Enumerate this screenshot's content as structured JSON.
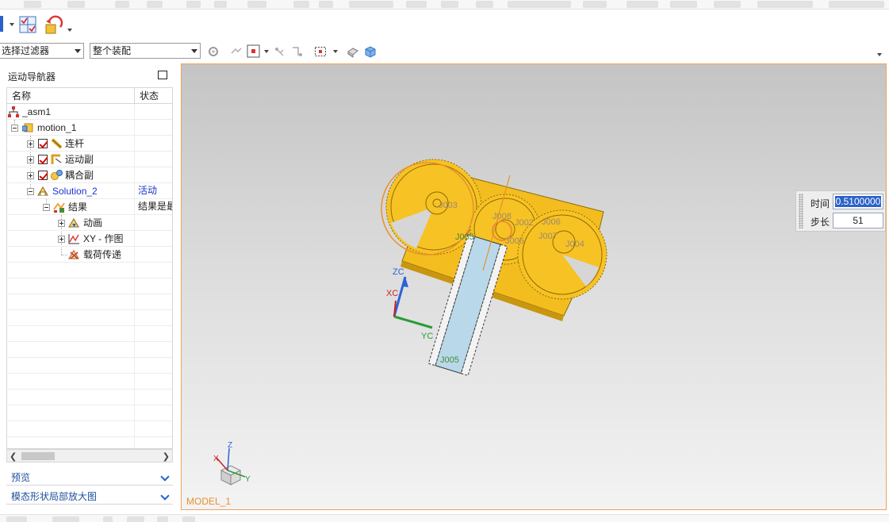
{
  "toolbar": {
    "filter_combo": "选择过滤器",
    "scope_combo": "整个装配"
  },
  "navigator": {
    "title": "运动导航器",
    "columns": {
      "name": "名称",
      "status": "状态"
    },
    "rows": [
      {
        "label": "_asm1",
        "status": ""
      },
      {
        "label": "motion_1",
        "status": ""
      },
      {
        "label": "连杆",
        "status": ""
      },
      {
        "label": "运动副",
        "status": ""
      },
      {
        "label": "耦合副",
        "status": ""
      },
      {
        "label": "Solution_2",
        "status": "活动"
      },
      {
        "label": "结果",
        "status": "结果是最"
      },
      {
        "label": "动画",
        "status": ""
      },
      {
        "label": "XY - 作图",
        "status": ""
      },
      {
        "label": "载荷传递",
        "status": ""
      }
    ]
  },
  "panels": {
    "preview": "预览",
    "magnifier": "模态形状局部放大图"
  },
  "viewport": {
    "model_name": "MODEL_1",
    "axes": {
      "zc": "ZC",
      "xc": "XC",
      "yc": "YC"
    },
    "triad": {
      "z": "Z",
      "x": "X",
      "y": "Y"
    },
    "part_labels": [
      "J003",
      "J008",
      "J002",
      "J006",
      "J007",
      "J005",
      "J004",
      "J005",
      "J005"
    ]
  },
  "animation": {
    "time_label": "时间",
    "time_value": "0.5100000",
    "step_label": "步长",
    "step_value": "51"
  },
  "colors": {
    "accent": "#f0a356",
    "gear": "#f7c223",
    "rack": "#b9d9ea",
    "link_blue": "#1f4e9c",
    "active": "#1a35c8"
  }
}
